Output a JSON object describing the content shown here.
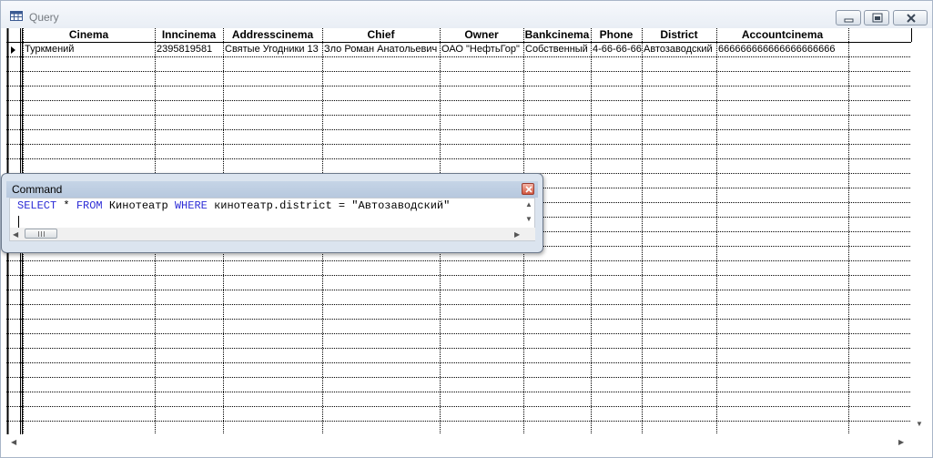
{
  "window": {
    "title": "Query",
    "controls": [
      "minimize-icon",
      "maximize-icon",
      "close-icon"
    ]
  },
  "grid": {
    "columns": [
      "Cinema",
      "Inncinema",
      "Addresscinema",
      "Chief",
      "Owner",
      "Bankcinema",
      "Phone",
      "District",
      "Accountcinema"
    ],
    "rows": [
      [
        "Туркмений",
        "2395819581",
        "Святые Угодники 13",
        "Зло Роман Анатольевич",
        "ОАО \"НефтьГор\"",
        "Собственный",
        "4-66-66-66",
        "Автозаводский",
        "666666666666666666666"
      ]
    ]
  },
  "command": {
    "title": "Command",
    "tokens": [
      {
        "text": "SELECT",
        "kw": true
      },
      {
        "text": " * ",
        "kw": false
      },
      {
        "text": "FROM",
        "kw": true
      },
      {
        "text": " Кинотеатр ",
        "kw": false
      },
      {
        "text": "WHERE",
        "kw": true
      },
      {
        "text": " кинотеатр.district = \"Автозаводский\"",
        "kw": false
      }
    ]
  },
  "colors": {
    "keyword": "#2d2dd6",
    "grid_line": "#000000",
    "title_text": "#757a80"
  }
}
